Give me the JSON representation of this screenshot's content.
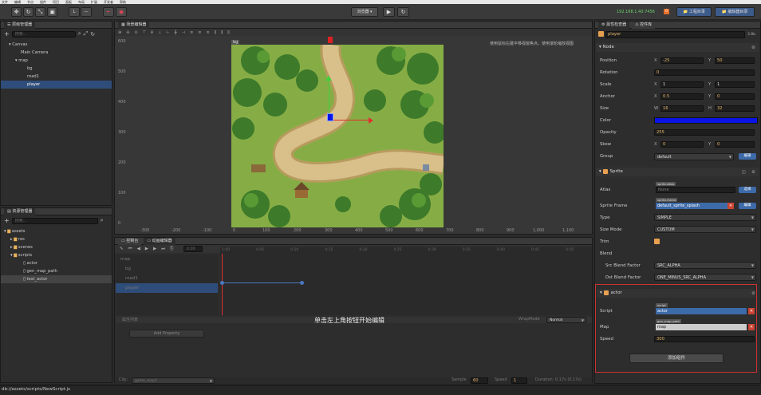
{
  "menubar": [
    "文件",
    "编辑",
    "节点",
    "组件",
    "项目",
    "面板",
    "布局",
    "扩展",
    "开发者",
    "帮助"
  ],
  "toolbar": {
    "preview_dropdown": "浏览器",
    "ip": "192.168.1.40:7456",
    "project_btn": "工程目录",
    "editor_btn": "编辑器目录",
    "badge": "0"
  },
  "hierarchy": {
    "title": "层级管理器",
    "search": "搜索...",
    "items": [
      "Canvas",
      "Main Camera",
      "map",
      "bg",
      "road1",
      "player"
    ]
  },
  "assets": {
    "title": "资源管理器",
    "search": "搜索...",
    "items": [
      "assets",
      "res",
      "scenes",
      "scripts",
      "actor",
      "gen_map_path",
      "test_actor"
    ]
  },
  "scene": {
    "title": "场景编辑器",
    "hint": "使用鼠标右键平移视窗焦点，使用滚轮缩放视图",
    "y_labels": [
      "600",
      "500",
      "400",
      "300",
      "200",
      "100",
      "0"
    ],
    "x_labels": [
      "-300",
      "-200",
      "-100",
      "0",
      "100",
      "200",
      "300",
      "400",
      "500",
      "600",
      "700",
      "800",
      "900",
      "1,000",
      "1,100"
    ],
    "bg_label": "bg"
  },
  "timeline": {
    "tab1": "控制台",
    "tab2": "动画编辑器",
    "tracks": [
      "map",
      "bg",
      "road1",
      "player"
    ],
    "ticks": [
      "1:00",
      "0:05",
      "0:10",
      "0:15",
      "0:20",
      "0:25",
      "0:30",
      "0:35",
      "0:40",
      "0:45",
      "0:50",
      "0:55",
      "1:00"
    ],
    "props_label": "属性列表",
    "add_property": "Add Property",
    "wrap_label": "WrapMode",
    "wrap_value": "Normal",
    "hint": "单击左上角按钮开始编辑",
    "clip_label": "Clip:",
    "clip_value": "game_map1",
    "sample_label": "Sample",
    "sample_value": "60",
    "speed_label": "Speed",
    "speed_value": "1",
    "duration": "Duration: 0.17s (0.17s)",
    "frame_value": "0:00"
  },
  "status": {
    "path": "db://assets/scripts/NewScript.js"
  },
  "inspector": {
    "tab1": "属性检查器",
    "tab2": "控件库",
    "node_name": "player",
    "version": "3.8b",
    "node_section": "Node",
    "position": {
      "label": "Position",
      "x": "-25",
      "y": "50"
    },
    "rotation": {
      "label": "Rotation",
      "v": "0"
    },
    "scale": {
      "label": "Scale",
      "x": "1",
      "y": "1"
    },
    "anchor": {
      "label": "Anchor",
      "x": "0.5",
      "y": "0"
    },
    "size": {
      "label": "Size",
      "w": "16",
      "h": "32"
    },
    "color": {
      "label": "Color",
      "value": "#0a14e6"
    },
    "opacity": {
      "label": "Opacity",
      "v": "255"
    },
    "skew": {
      "label": "Skew",
      "x": "0",
      "y": "0"
    },
    "group": {
      "label": "Group",
      "v": "default",
      "btn": "编辑"
    },
    "sprite_section": "Sprite",
    "atlas": {
      "label": "Atlas",
      "tag": "sprite-atlas",
      "v": "None",
      "btn": "选择"
    },
    "frame": {
      "label": "Sprite Frame",
      "tag": "sprite-frame",
      "v": "default_sprite_splash",
      "btn": "编辑"
    },
    "type": {
      "label": "Type",
      "v": "SIMPLE"
    },
    "sizemode": {
      "label": "Size Mode",
      "v": "CUSTOM"
    },
    "trim": {
      "label": "Trim"
    },
    "blend": {
      "label": "Blend"
    },
    "src": {
      "label": "Src Blend Factor",
      "v": "SRC_ALPHA"
    },
    "dst": {
      "label": "Dst Blend Factor",
      "v": "ONE_MINUS_SRC_ALPHA"
    },
    "actor_section": "actor",
    "script": {
      "label": "Script",
      "tag": "script",
      "v": "actor"
    },
    "map": {
      "label": "Map",
      "tag": "gen_map_path",
      "v": "map"
    },
    "speed": {
      "label": "Speed",
      "v": "300"
    },
    "add_component": "添加组件"
  }
}
